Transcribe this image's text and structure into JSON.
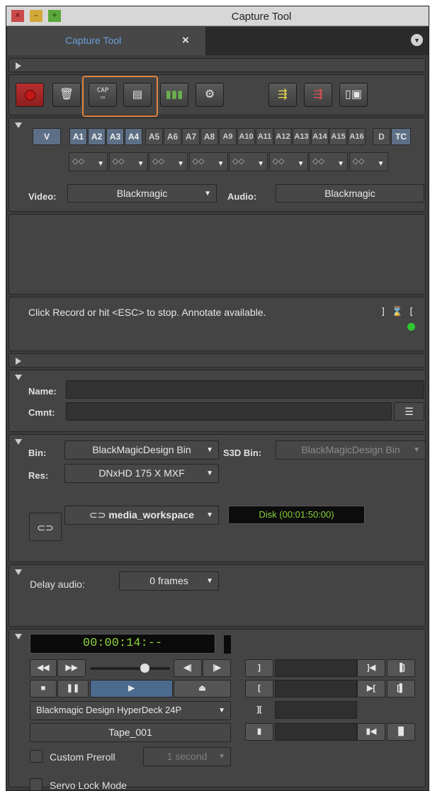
{
  "window": {
    "title": "Capture Tool",
    "tab_label": "Capture Tool",
    "tab_close": "×",
    "menu_glyph": "▼",
    "controls": {
      "close": "×",
      "minimize": "–",
      "maximize": "+"
    }
  },
  "toolbar": {
    "icons": [
      "record-icon",
      "trash-icon",
      "cap-icon",
      "deck-icon",
      "meter-icon",
      "settings-icon",
      "import-icon",
      "export-icon",
      "monitor-icon"
    ],
    "cap_label": "CAP"
  },
  "tracks": {
    "labels": [
      "V",
      "A1",
      "A2",
      "A3",
      "A4",
      "A5",
      "A6",
      "A7",
      "A8",
      "A9",
      "A10",
      "A11",
      "A12",
      "A13",
      "A14",
      "A15",
      "A16",
      "D",
      "TC"
    ],
    "active": [
      "V",
      "A1",
      "A2",
      "A3",
      "A4",
      "TC"
    ],
    "pair_dropdown_value": "◇◇",
    "video_label": "Video:",
    "video_value": "Blackmagic",
    "audio_label": "Audio:",
    "audio_value": "Blackmagic"
  },
  "status": {
    "message": "Click Record or hit <ESC> to stop. Annotate available.",
    "indicator_color": "#2ec82e"
  },
  "clip": {
    "name_label": "Name:",
    "name_value": "",
    "comment_label": "Cmnt:",
    "comment_value": ""
  },
  "target": {
    "bin_label": "Bin:",
    "bin_value": "BlackMagicDesign Bin",
    "s3d_label": "S3D Bin:",
    "s3d_value": "BlackMagicDesign Bin",
    "res_label": "Res:",
    "res_value": "DNxHD 175 X  MXF",
    "drive_value": "media_workspace",
    "disk_status": "Disk (00:01:50:00)"
  },
  "delay": {
    "label": "Delay audio:",
    "value": "0 frames"
  },
  "deck": {
    "timecode": "00:00:14:--",
    "deck_name": "Blackmagic Design HyperDeck 24P",
    "tape_name": "Tape_001",
    "custom_preroll_label": "Custom Preroll",
    "custom_preroll_value": "1 second",
    "custom_preroll_checked": false,
    "servo_lock_label": "Servo Lock Mode",
    "servo_lock_checked": false,
    "shuttle_position": 0.63
  },
  "colors": {
    "accent_highlight": "#e08440",
    "track_active": "#5d6f86",
    "timecode_green": "#8fd43c"
  }
}
